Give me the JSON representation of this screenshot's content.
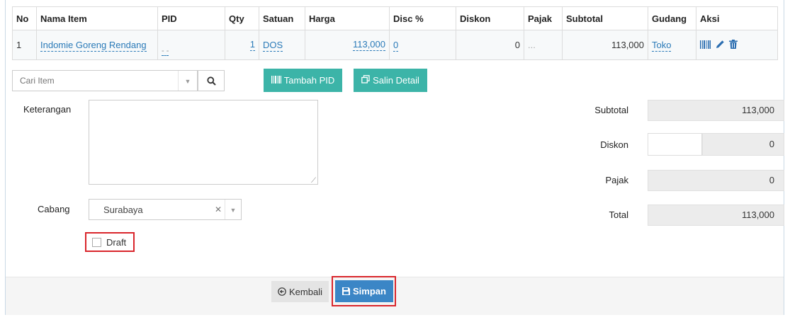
{
  "table": {
    "headers": {
      "no": "No",
      "item": "Nama Item",
      "pid": "PID",
      "qty": "Qty",
      "satuan": "Satuan",
      "harga": "Harga",
      "disc": "Disc %",
      "diskon": "Diskon",
      "pajak": "Pajak",
      "subtotal": "Subtotal",
      "gudang": "Gudang",
      "aksi": "Aksi"
    },
    "row": {
      "no": "1",
      "item": "Indomie Goreng Rendang",
      "pid": "- -",
      "qty": "1",
      "satuan": "DOS",
      "harga": "113,000",
      "disc": "0",
      "diskon": "0",
      "pajak": "...",
      "subtotal": "113,000",
      "gudang": "Toko"
    }
  },
  "search": {
    "placeholder": "Cari Item"
  },
  "buttons": {
    "tambah_pid": "Tambah PID",
    "salin_detail": "Salin Detail",
    "kembali": "Kembali",
    "simpan": "Simpan"
  },
  "form": {
    "keterangan_label": "Keterangan",
    "keterangan_value": "",
    "cabang_label": "Cabang",
    "cabang_value": "Surabaya",
    "draft_label": "Draft",
    "draft_checked": false
  },
  "summary": {
    "subtotal_label": "Subtotal",
    "subtotal_value": "113,000",
    "diskon_label": "Diskon",
    "diskon_value": "0",
    "pajak_label": "Pajak",
    "pajak_value": "0",
    "total_label": "Total",
    "total_value": "113,000"
  },
  "colors": {
    "teal": "#3cb4a8",
    "primary": "#3b86c6",
    "highlight": "#d9262c",
    "link": "#2a7ab8"
  },
  "icons": [
    "search-icon",
    "barcode-icon",
    "copy-icon",
    "pencil-icon",
    "trash-icon",
    "back-circle-icon",
    "save-icon"
  ]
}
